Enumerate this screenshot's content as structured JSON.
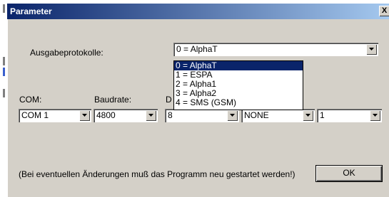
{
  "window": {
    "title": "Parameter",
    "close_label": "X"
  },
  "protocol": {
    "label": "Ausgabeprotokolle:",
    "value": "0 = AlphaT",
    "options": [
      "0 = AlphaT",
      "1 = ESPA",
      "2 = Alpha1",
      "3 = Alpha2",
      "4 = SMS (GSM)"
    ],
    "selected_index": 0
  },
  "com": {
    "label": "COM:",
    "value": "COM 1"
  },
  "baud": {
    "label": "Baudrate:",
    "value": "4800"
  },
  "databits": {
    "label": "D",
    "value": "8"
  },
  "parity": {
    "value": "NONE"
  },
  "stopbits": {
    "value": "1"
  },
  "notice": "(Bei eventuellen Änderungen muß das Programm neu gestartet werden!)",
  "ok_label": "OK",
  "colors": {
    "title_start": "#0a246a",
    "title_end": "#a6caf0",
    "face": "#d4d0c8",
    "selection": "#0a246a"
  }
}
